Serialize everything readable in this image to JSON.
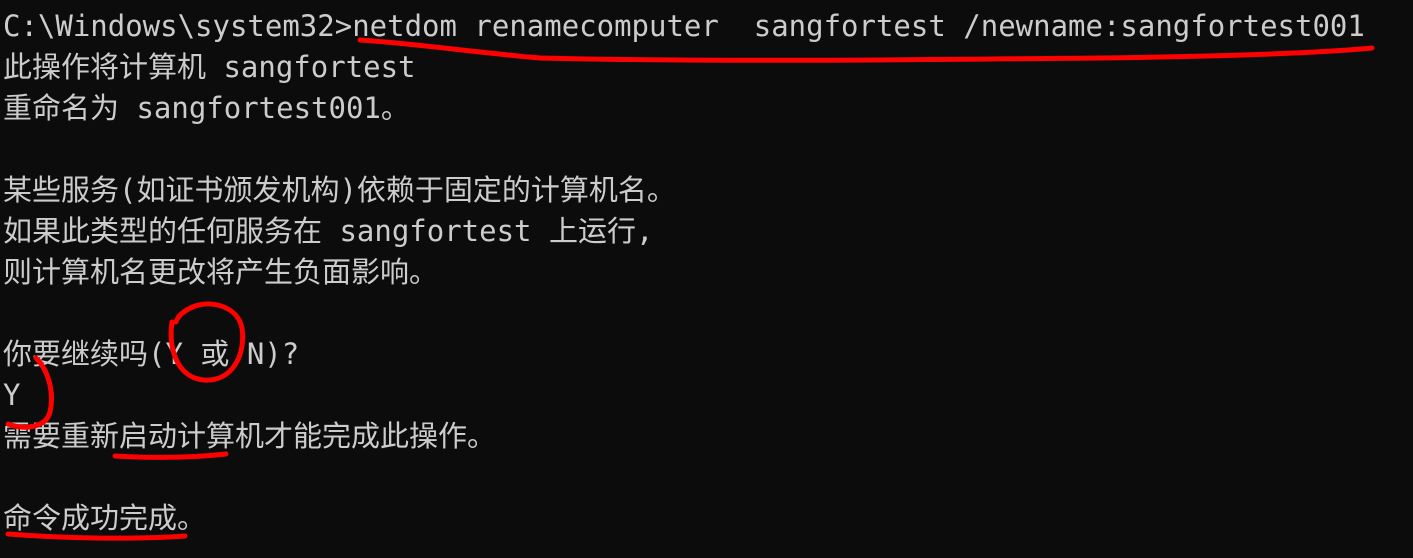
{
  "console": {
    "lines": [
      "C:\\Windows\\system32>netdom renamecomputer  sangfortest /newname:sangfortest001",
      "此操作将计算机 sangfortest",
      "重命名为 sangfortest001。",
      "",
      "某些服务(如证书颁发机构)依赖于固定的计算机名。",
      "如果此类型的任何服务在 sangfortest 上运行,",
      "则计算机名更改将产生负面影响。",
      "",
      "你要继续吗(Y 或 N)?",
      "Y",
      "需要重新启动计算机才能完成此操作。",
      "",
      "命令成功完成。"
    ]
  },
  "annotations": {
    "color": "#ff0000"
  }
}
